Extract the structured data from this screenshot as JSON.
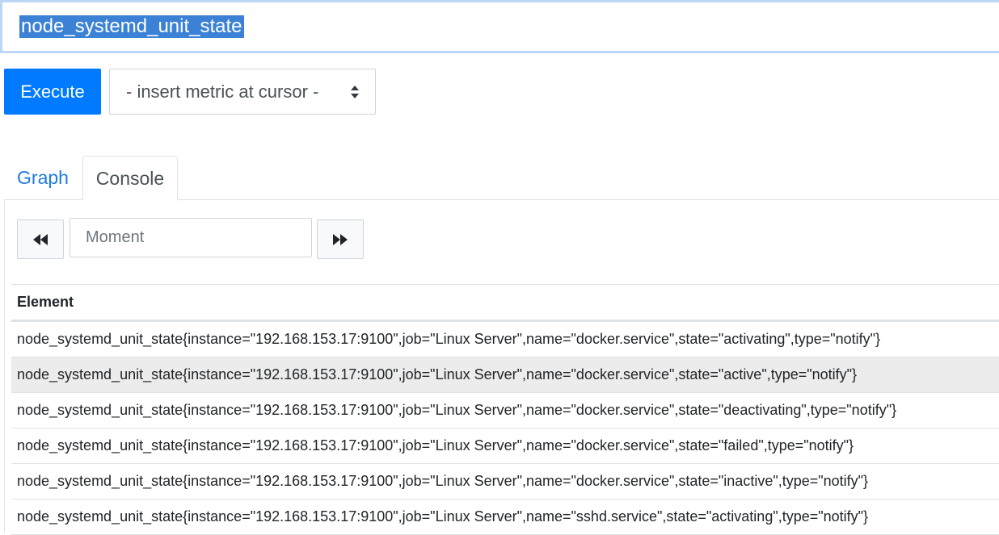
{
  "query": {
    "text": "node_systemd_unit_state"
  },
  "toolbar": {
    "execute_label": "Execute",
    "metric_select_value": "- insert metric at cursor -"
  },
  "tabs": [
    {
      "label": "Graph",
      "active": false
    },
    {
      "label": "Console",
      "active": true
    }
  ],
  "console": {
    "back_icon": "fast-backward-icon",
    "forward_icon": "fast-forward-icon",
    "moment_placeholder": "Moment"
  },
  "table": {
    "header": "Element",
    "rows": [
      "node_systemd_unit_state{instance=\"192.168.153.17:9100\",job=\"Linux Server\",name=\"docker.service\",state=\"activating\",type=\"notify\"}",
      "node_systemd_unit_state{instance=\"192.168.153.17:9100\",job=\"Linux Server\",name=\"docker.service\",state=\"active\",type=\"notify\"}",
      "node_systemd_unit_state{instance=\"192.168.153.17:9100\",job=\"Linux Server\",name=\"docker.service\",state=\"deactivating\",type=\"notify\"}",
      "node_systemd_unit_state{instance=\"192.168.153.17:9100\",job=\"Linux Server\",name=\"docker.service\",state=\"failed\",type=\"notify\"}",
      "node_systemd_unit_state{instance=\"192.168.153.17:9100\",job=\"Linux Server\",name=\"docker.service\",state=\"inactive\",type=\"notify\"}",
      "node_systemd_unit_state{instance=\"192.168.153.17:9100\",job=\"Linux Server\",name=\"sshd.service\",state=\"activating\",type=\"notify\"}"
    ]
  },
  "colors": {
    "primary": "#007bff",
    "link": "#1f7ae0",
    "selection": "#3b82d6",
    "row_stripe": "#ececec"
  }
}
